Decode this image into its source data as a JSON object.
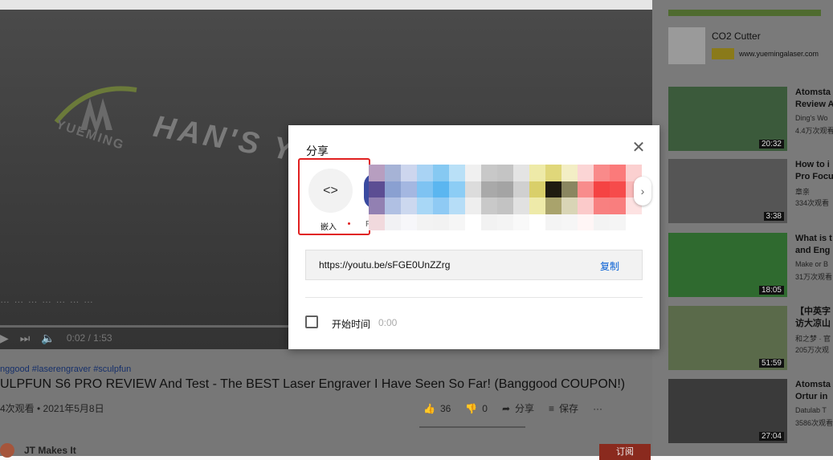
{
  "player": {
    "logo_text": "YUEMING",
    "hans_text": "HAN'S Y",
    "subtitle": "… … … … … … …",
    "time": "0:02 / 1:53"
  },
  "video": {
    "hashtags": "nggood #laserengraver #sculpfun",
    "title": "ULPFUN S6 PRO REVIEW And Test - The BEST Laser Engraver I Have Seen So Far! (Banggood COUPON!)",
    "meta": "4次观看 • 2021年5月8日",
    "likes": "36",
    "dislikes": "0",
    "share_label": "分享",
    "save_label": "保存",
    "more": "···",
    "channel_name": "JT Makes It",
    "subscribe_label": "订阅"
  },
  "sidebar": {
    "ad": {
      "title": "CO2 Cutter",
      "url": "www.yuemingalaser.com"
    },
    "recs": [
      {
        "title": "Atomsta",
        "line2": "Review A",
        "meta1": "Ding's Wo",
        "meta2": "4.4万次观看",
        "duration": "20:32"
      },
      {
        "title": "How to i",
        "line2": "Pro Focu",
        "meta1": "章亲",
        "meta2": "334次观看",
        "duration": "3:38"
      },
      {
        "title": "What is t",
        "line2": "and Eng",
        "meta1": "Make or B",
        "meta2": "31万次观看",
        "duration": "18:05"
      },
      {
        "title": "【中英字",
        "line2": "访大凉山",
        "meta1": "和之梦 · 官",
        "meta2": "205万次观",
        "duration": "51:59"
      },
      {
        "title": "Atomsta",
        "line2": "Ortur in",
        "meta1": "Datulab T",
        "meta2": "3586次观看",
        "duration": "27:04"
      }
    ]
  },
  "dialog": {
    "title": "分享",
    "embed_label": "嵌入",
    "partial_label": "F",
    "next_icon": "›",
    "url": "https://youtu.be/sFGE0UnZZrg",
    "copy_label": "复制",
    "start_label": "开始时间",
    "start_time": "0:00",
    "colors": {
      "accent": "#065fd4",
      "highlight": "#e02020"
    }
  }
}
